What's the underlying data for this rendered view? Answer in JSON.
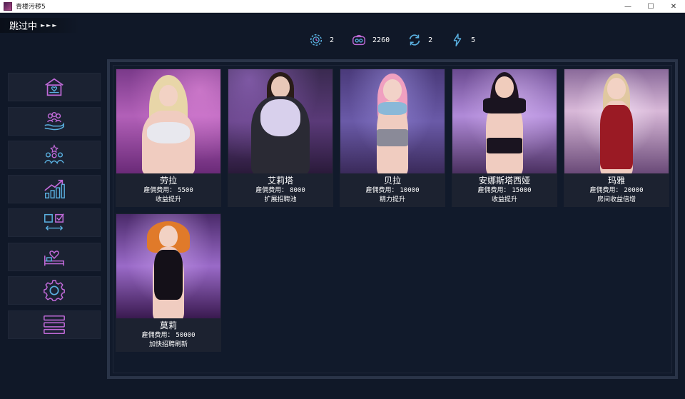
{
  "window": {
    "title": "青楼污秽5",
    "controls": [
      "—",
      "☐",
      "✕"
    ]
  },
  "skip": {
    "label": "跳过中",
    "arrows": "►►►"
  },
  "resources": [
    {
      "icon": "clock-gear-icon",
      "value": "2"
    },
    {
      "icon": "coin-purse-icon",
      "value": "2260"
    },
    {
      "icon": "refresh-icon",
      "value": "2"
    },
    {
      "icon": "lightning-icon",
      "value": "5"
    }
  ],
  "sidebar": {
    "items": [
      {
        "icon": "brothel-house-icon"
      },
      {
        "icon": "hire-hand-icon"
      },
      {
        "icon": "staff-group-icon"
      },
      {
        "icon": "growth-chart-icon"
      },
      {
        "icon": "swap-checklist-icon"
      },
      {
        "icon": "room-bed-icon"
      },
      {
        "icon": "settings-gear-icon"
      },
      {
        "icon": "menu-list-icon"
      }
    ]
  },
  "cost_label": "雇佣费用：",
  "cards": [
    {
      "name": "劳拉",
      "cost": "5500",
      "skill": "收益提升"
    },
    {
      "name": "艾莉塔",
      "cost": "8000",
      "skill": "扩展招聘池"
    },
    {
      "name": "贝拉",
      "cost": "10000",
      "skill": "精力提升"
    },
    {
      "name": "安娜斯塔西娅",
      "cost": "15000",
      "skill": "收益提升"
    },
    {
      "name": "玛雅",
      "cost": "20000",
      "skill": "房间收益倍增"
    },
    {
      "name": "莫莉",
      "cost": "50000",
      "skill": "加快招聘刷新"
    }
  ],
  "colors": {
    "background": "#101828",
    "icon_accent": "#c06ad8",
    "icon_secondary": "#5ab0e0"
  }
}
